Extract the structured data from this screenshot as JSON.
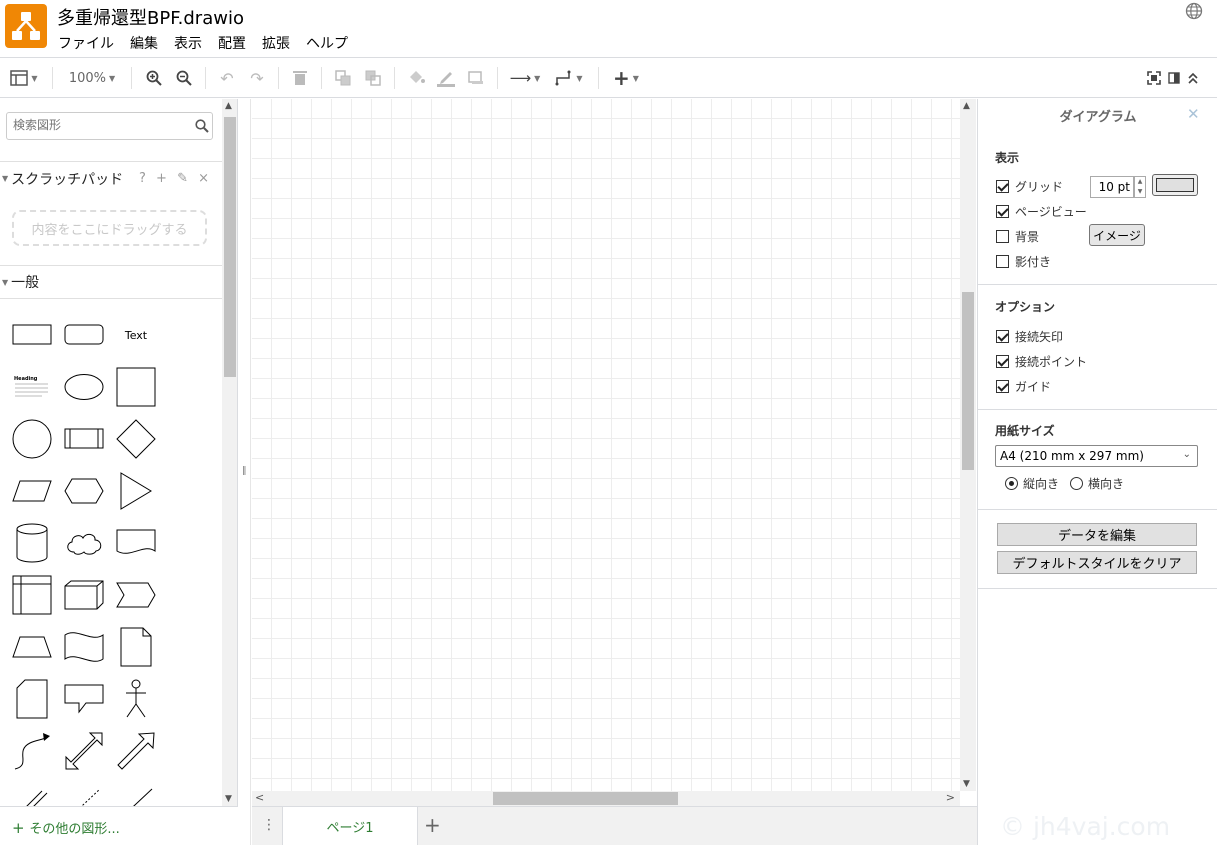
{
  "app": {
    "title": "多重帰還型BPF.drawio",
    "menus": [
      "ファイル",
      "編集",
      "表示",
      "配置",
      "拡張",
      "ヘルプ"
    ]
  },
  "toolbar": {
    "zoom": "100%"
  },
  "sidebar": {
    "search_placeholder": "検索図形",
    "scratchpad_title": "スクラッチパッド",
    "scratchpad_tools": "? + ✎ ×",
    "scratchpad_drop": "内容をここにドラッグする",
    "general_title": "一般",
    "text_shape_label": "Text",
    "heading_shape_label": "Heading",
    "more_shapes": "その他の図形..."
  },
  "pages": {
    "active_tab": "ページ1"
  },
  "format_panel": {
    "title": "ダイアグラム",
    "view_section": "表示",
    "grid_label": "グリッド",
    "grid_checked": true,
    "grid_size": "10 pt",
    "page_view_label": "ページビュー",
    "page_view_checked": true,
    "background_label": "背景",
    "background_checked": false,
    "image_button": "イメージ",
    "shadow_label": "影付き",
    "shadow_checked": false,
    "options_section": "オプション",
    "connection_arrows_label": "接続矢印",
    "connection_points_label": "接続ポイント",
    "guides_label": "ガイド",
    "paper_section": "用紙サイズ",
    "paper_size": "A4 (210 mm x 297 mm)",
    "portrait_label": "縦向き",
    "landscape_label": "横向き",
    "portrait_selected": true,
    "edit_data_button": "データを編集",
    "clear_style_button": "デフォルトスタイルをクリア"
  },
  "watermark": "© jh4vaj.com",
  "colors": {
    "logo": "#f08705",
    "accent_green": "#2e7d32"
  }
}
